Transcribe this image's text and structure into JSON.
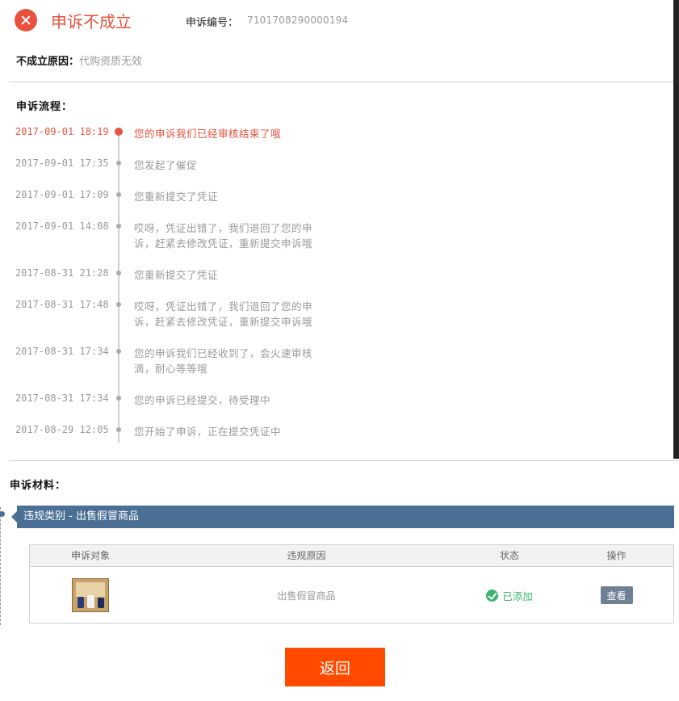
{
  "header": {
    "status_icon": "close-circle-icon",
    "status_title": "申诉不成立",
    "id_label": "申诉编号：",
    "id_value": "7101708290000194"
  },
  "reason": {
    "label": "不成立原因：",
    "value": "代购资质无效"
  },
  "flow": {
    "title": "申诉流程：",
    "entries": [
      {
        "time": "2017-09-01 18:19",
        "text": "您的申诉我们已经审核结束了哦",
        "current": true
      },
      {
        "time": "2017-09-01 17:35",
        "text": "您发起了催促"
      },
      {
        "time": "2017-09-01 17:09",
        "text": "您重新提交了凭证"
      },
      {
        "time": "2017-09-01 14:08",
        "text": "哎呀，凭证出错了，我们退回了您的申诉，赶紧去修改凭证，重新提交申诉哦"
      },
      {
        "time": "2017-08-31 21:28",
        "text": "您重新提交了凭证"
      },
      {
        "time": "2017-08-31 17:48",
        "text": "哎呀，凭证出错了，我们退回了您的申诉，赶紧去修改凭证，重新提交申诉哦"
      },
      {
        "time": "2017-08-31 17:34",
        "text": "您的申诉我们已经收到了，会火速审核滴，耐心等等哦"
      },
      {
        "time": "2017-08-31 17:34",
        "text": "您的申诉已经提交，待受理中"
      },
      {
        "time": "2017-08-29 12:05",
        "text": "您开始了申诉，正在提交凭证中"
      }
    ]
  },
  "materials": {
    "title": "申诉材料：",
    "category": "违规类别 - 出售假冒商品",
    "table": {
      "headers": [
        "申诉对象",
        "违规原因",
        "状态",
        "操作"
      ],
      "rows": [
        {
          "reason": "出售假冒商品",
          "status": "已添加",
          "action": "查看"
        }
      ]
    }
  },
  "footer": {
    "back_label": "返回"
  },
  "colors": {
    "accent_red": "#e8513d",
    "category_bar": "#4a6f95",
    "status_green": "#3cb371",
    "back_button": "#ff4a00"
  }
}
